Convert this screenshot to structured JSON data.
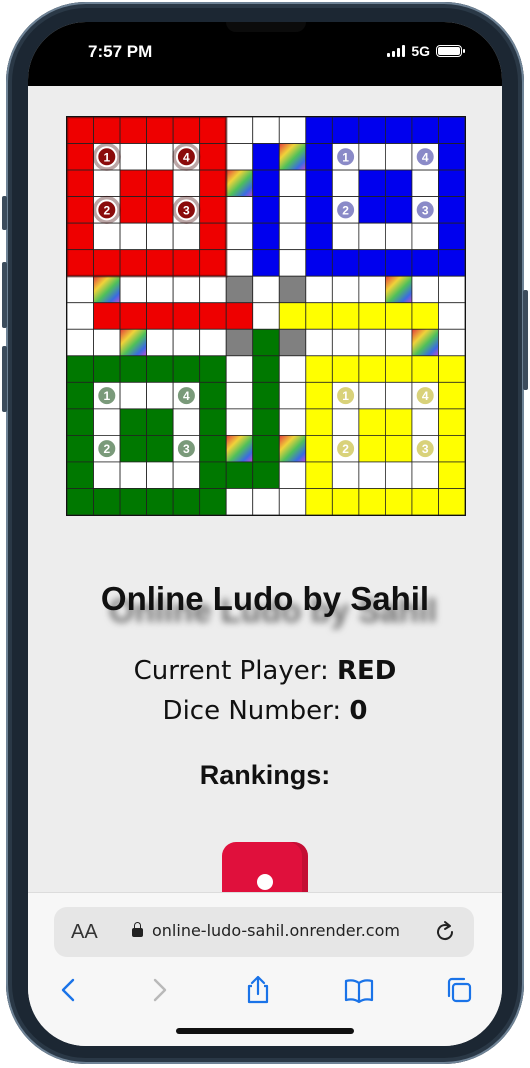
{
  "status_bar": {
    "time": "7:57 PM",
    "network": "5G"
  },
  "board": {
    "colors": {
      "red": "#ee0000",
      "blue": "#0000ee",
      "green": "#007800",
      "yellow": "#ffff00",
      "center_gray": "#808080"
    },
    "token_colors": {
      "red": "#8b0b0b",
      "blue": "#8a8ac8",
      "green": "#7a9a7a",
      "yellow": "#d9d27a"
    },
    "token_labels": [
      "1",
      "2",
      "3",
      "4"
    ]
  },
  "game": {
    "title": "Online Ludo by Sahil",
    "current_player_label": "Current Player:",
    "current_player_value": "RED",
    "dice_number_label": "Dice Number:",
    "dice_number_value": "0",
    "rankings_label": "Rankings:",
    "dice_color": "#e0103c"
  },
  "browser": {
    "text_size_label": "AA",
    "url": "online-ludo-sahil.onrender.com",
    "toolbar": [
      "back-icon",
      "forward-icon",
      "share-icon",
      "bookmarks-icon",
      "tabs-icon"
    ]
  }
}
